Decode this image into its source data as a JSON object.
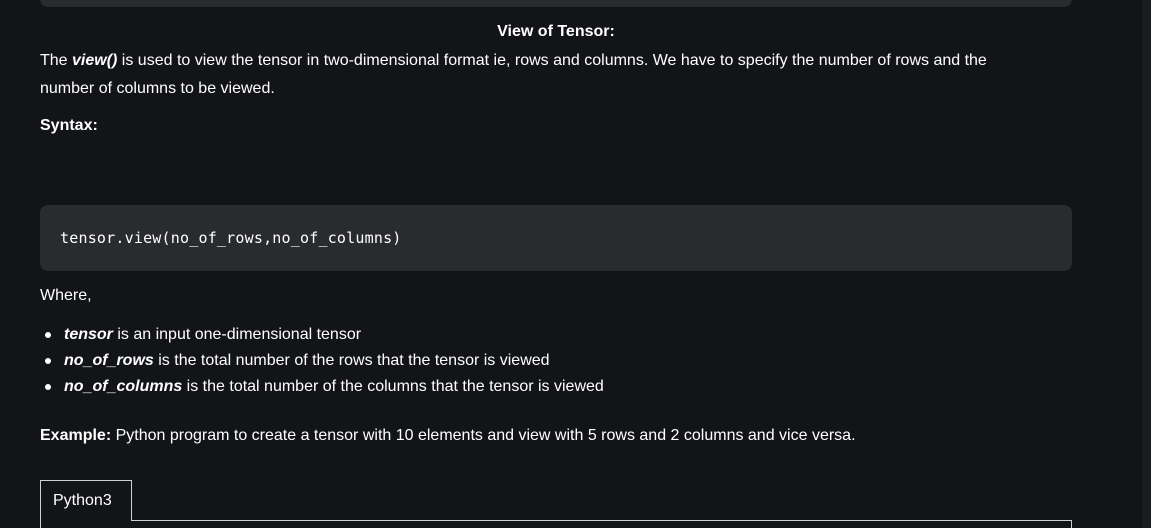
{
  "heading": "View of Tensor:",
  "intro": {
    "prefix": "The ",
    "keyword": "view()",
    "line1_rest": " is used to view the tensor in two-dimensional format ie, rows and columns. We have to specify the number of rows and the",
    "line2": "number of columns to be viewed."
  },
  "syntax_label": "Syntax:",
  "code": "tensor.view(no_of_rows,no_of_columns)",
  "where_label": "Where,",
  "params": [
    {
      "name": "tensor",
      "desc": " is an input one-dimensional tensor"
    },
    {
      "name": "no_of_rows",
      "desc": " is the total number of the rows that the tensor is viewed"
    },
    {
      "name": "no_of_columns",
      "desc": " is the total number of the columns  that the tensor is viewed"
    }
  ],
  "example": {
    "label": "Example:",
    "text": " Python program to create a tensor with 10 elements and view with 5 rows and 2 columns and vice versa."
  },
  "tabs": [
    {
      "label": "Python3"
    }
  ]
}
